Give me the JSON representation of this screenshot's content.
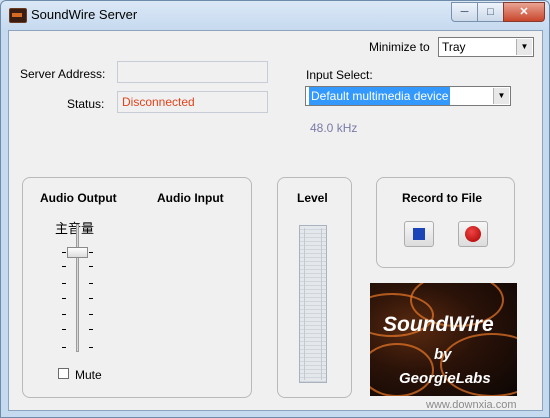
{
  "window": {
    "title": "SoundWire Server"
  },
  "titlebar": {
    "min_icon": "minimize-icon",
    "max_icon": "maximize-icon",
    "close_icon": "close-icon"
  },
  "minimize": {
    "label": "Minimize to",
    "value": "Tray"
  },
  "server": {
    "address_label": "Server Address:",
    "address_value": "",
    "status_label": "Status:",
    "status_value": "Disconnected",
    "status_color": "#e0441b"
  },
  "input": {
    "label": "Input Select:",
    "value": "Default multimedia device",
    "rate": "48.0 kHz"
  },
  "audio": {
    "output_label": "Audio Output",
    "input_label": "Audio Input",
    "volume_label": "主音量",
    "mute_label": "Mute",
    "mute_checked": false
  },
  "level": {
    "label": "Level"
  },
  "record": {
    "label": "Record to File",
    "stop_icon": "stop-icon",
    "record_icon": "record-icon"
  },
  "logo": {
    "name": "SoundWire",
    "by": "by",
    "maker": "GeorgieLabs"
  },
  "watermark": "www.downxia.com"
}
